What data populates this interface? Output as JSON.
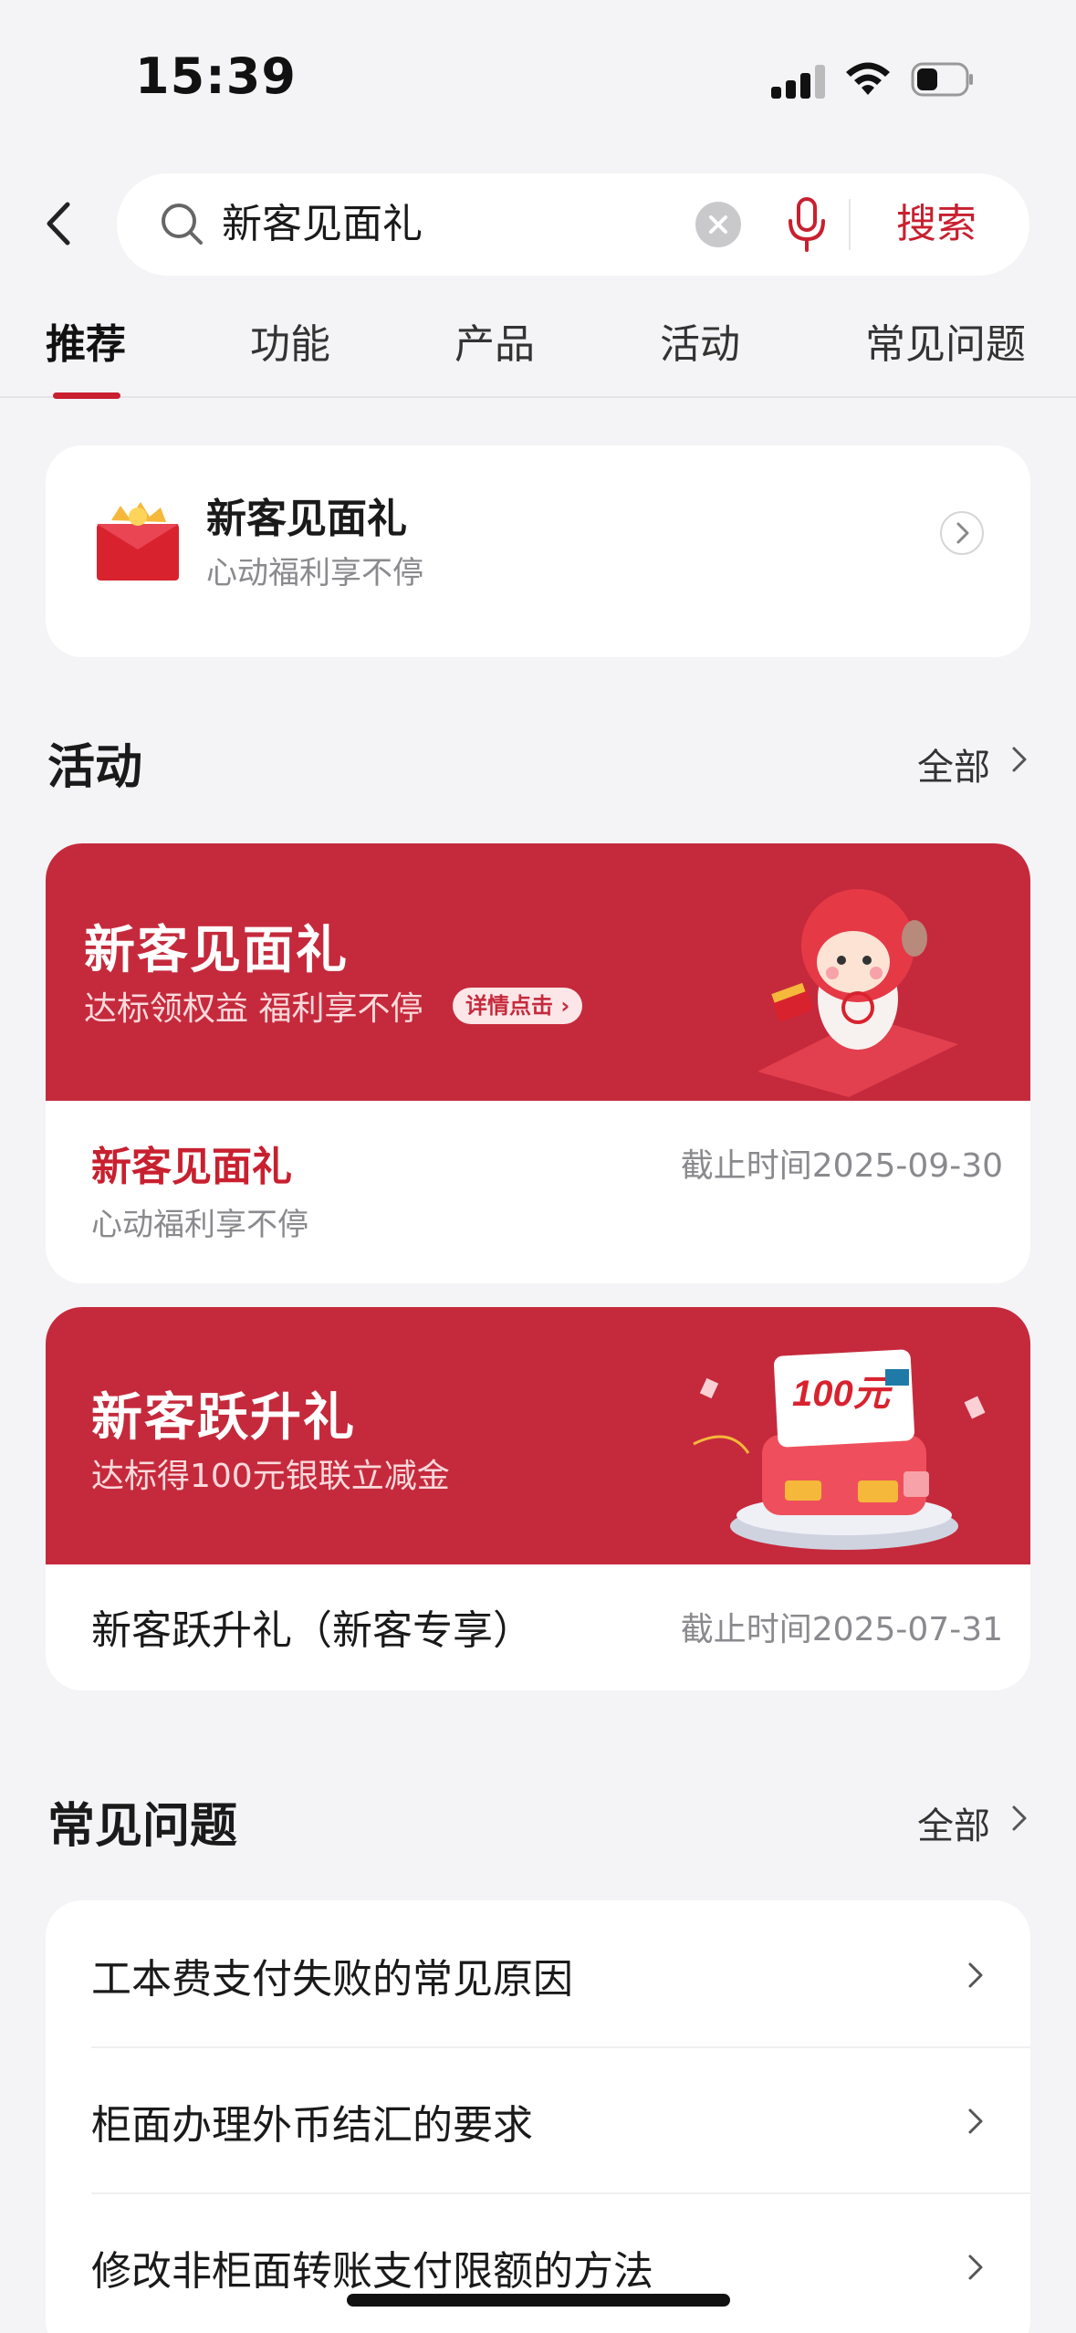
{
  "status": {
    "time": "15:39"
  },
  "search": {
    "value": "新客见面礼",
    "button_label": "搜索"
  },
  "tabs": [
    {
      "label": "推荐",
      "active": true
    },
    {
      "label": "功能",
      "active": false
    },
    {
      "label": "产品",
      "active": false
    },
    {
      "label": "活动",
      "active": false
    },
    {
      "label": "常见问题",
      "active": false
    }
  ],
  "feature": {
    "title": "新客见面礼",
    "subtitle": "心动福利享不停"
  },
  "activities_section": {
    "title": "活动",
    "more_label": "全部"
  },
  "activities": [
    {
      "banner_title": "新客见面礼",
      "banner_subtitle": "达标领权益 福利享不停",
      "banner_pill": "详情点击",
      "name": "新客见面礼",
      "deadline": "截止时间2025-09-30",
      "description": "心动福利享不停"
    },
    {
      "banner_title": "新客跃升礼",
      "banner_subtitle": "达标得100元银联立减金",
      "banner_amount": "100元",
      "name": "新客跃升礼（新客专享）",
      "deadline": "截止时间2025-07-31"
    }
  ],
  "faq_section": {
    "title": "常见问题",
    "more_label": "全部"
  },
  "faq": [
    "工本费支付失败的常见原因",
    "柜面办理外币结汇的要求",
    "修改非柜面转账支付限额的方法"
  ],
  "colors": {
    "accent": "#c8202f",
    "banner_red": "#c52a3c",
    "background": "#f4f4f6"
  }
}
